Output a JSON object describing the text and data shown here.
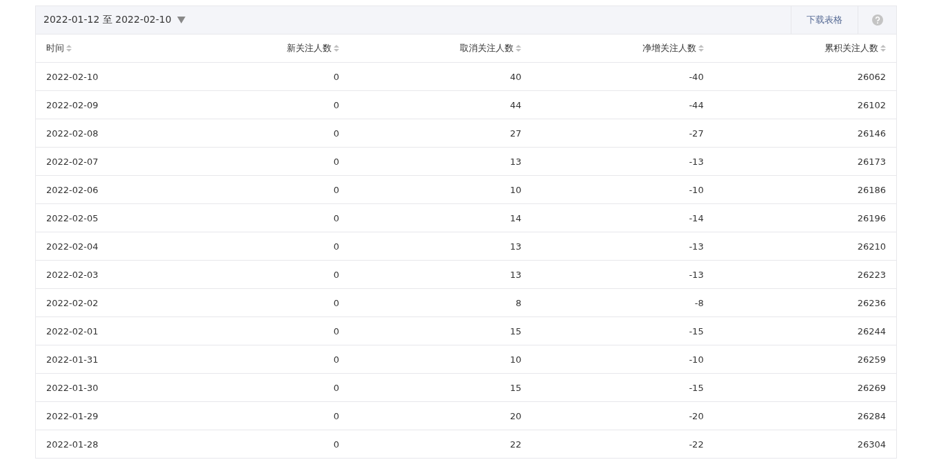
{
  "toolbar": {
    "date_range": "2022-01-12 至 2022-02-10",
    "download_label": "下载表格"
  },
  "table": {
    "columns": [
      {
        "label": "时间"
      },
      {
        "label": "新关注人数"
      },
      {
        "label": "取消关注人数"
      },
      {
        "label": "净增关注人数"
      },
      {
        "label": "累积关注人数"
      }
    ],
    "rows": [
      [
        "2022-02-10",
        "0",
        "40",
        "-40",
        "26062"
      ],
      [
        "2022-02-09",
        "0",
        "44",
        "-44",
        "26102"
      ],
      [
        "2022-02-08",
        "0",
        "27",
        "-27",
        "26146"
      ],
      [
        "2022-02-07",
        "0",
        "13",
        "-13",
        "26173"
      ],
      [
        "2022-02-06",
        "0",
        "10",
        "-10",
        "26186"
      ],
      [
        "2022-02-05",
        "0",
        "14",
        "-14",
        "26196"
      ],
      [
        "2022-02-04",
        "0",
        "13",
        "-13",
        "26210"
      ],
      [
        "2022-02-03",
        "0",
        "13",
        "-13",
        "26223"
      ],
      [
        "2022-02-02",
        "0",
        "8",
        "-8",
        "26236"
      ],
      [
        "2022-02-01",
        "0",
        "15",
        "-15",
        "26244"
      ],
      [
        "2022-01-31",
        "0",
        "10",
        "-10",
        "26259"
      ],
      [
        "2022-01-30",
        "0",
        "15",
        "-15",
        "26269"
      ],
      [
        "2022-01-29",
        "0",
        "20",
        "-20",
        "26284"
      ],
      [
        "2022-01-28",
        "0",
        "22",
        "-22",
        "26304"
      ]
    ]
  }
}
